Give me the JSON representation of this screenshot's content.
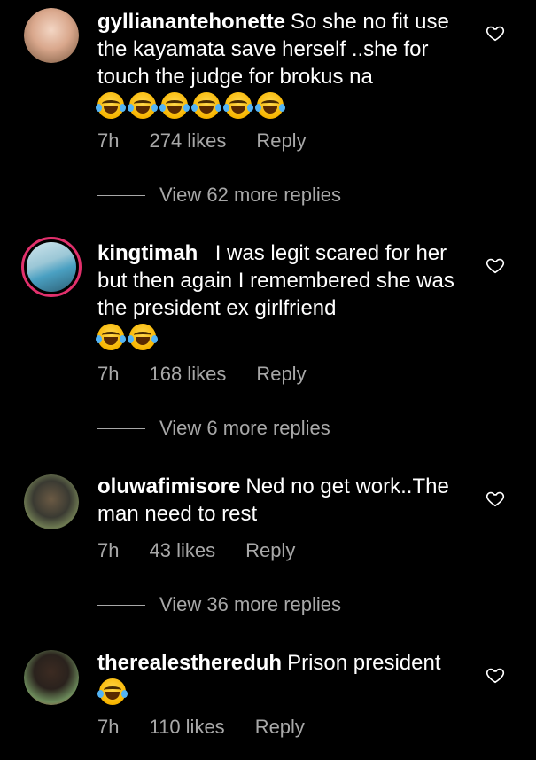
{
  "comments": [
    {
      "username": "gyllianantehonette",
      "text": "So she no fit use the kayamata save herself ..she for touch the judge for brokus na",
      "emoji_count": 6,
      "time": "7h",
      "likes": "274 likes",
      "reply": "Reply",
      "view_replies": "View 62 more replies"
    },
    {
      "username": "kingtimah_",
      "text": "I was legit scared for her but then again I remembered she was the president ex girlfriend",
      "emoji_count": 2,
      "time": "7h",
      "likes": "168 likes",
      "reply": "Reply",
      "view_replies": "View 6 more replies"
    },
    {
      "username": "oluwafimisore",
      "text": "Ned no get work..The man need to rest",
      "emoji_count": 0,
      "time": "7h",
      "likes": "43 likes",
      "reply": "Reply",
      "view_replies": "View 36 more replies"
    },
    {
      "username": "therealesthereduh",
      "text": "Prison president",
      "emoji_count": 1,
      "time": "7h",
      "likes": "110 likes",
      "reply": "Reply"
    }
  ],
  "icons": {
    "like": "heart-outline-icon",
    "emoji": "face-with-tears-of-joy"
  },
  "colors": {
    "background": "#000000",
    "text": "#ffffff",
    "meta": "#a8a8a8",
    "story_ring": "#e1306c"
  }
}
